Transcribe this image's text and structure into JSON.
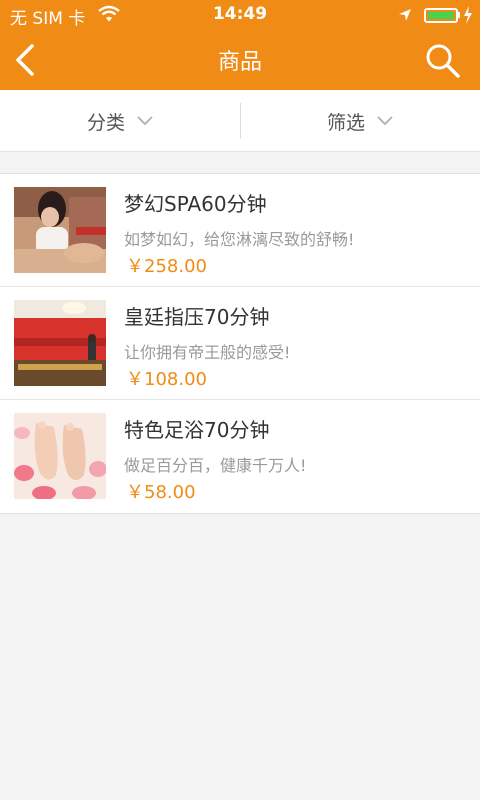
{
  "status_bar": {
    "carrier": "无 SIM 卡",
    "time": "14:49",
    "battery_level": 1.0,
    "icons": [
      "wifi-icon",
      "location-arrow-icon",
      "battery-icon",
      "charging-bolt-icon"
    ]
  },
  "nav": {
    "title": "商品",
    "back_icon": "chevron-left-icon",
    "search_icon": "search-icon"
  },
  "filters": {
    "category_label": "分类",
    "filter_label": "筛选"
  },
  "products": [
    {
      "title": "梦幻SPA60分钟",
      "desc": "如梦如幻，给您淋漓尽致的舒畅!",
      "price": "￥258.00"
    },
    {
      "title": "皇廷指压70分钟",
      "desc": "让你拥有帝王般的感受!",
      "price": "￥108.00"
    },
    {
      "title": "特色足浴70分钟",
      "desc": "做足百分百，健康千万人!",
      "price": "￥58.00"
    }
  ],
  "colors": {
    "accent": "#f08c16",
    "background": "#f3f3f3",
    "battery": "#49d34c"
  }
}
